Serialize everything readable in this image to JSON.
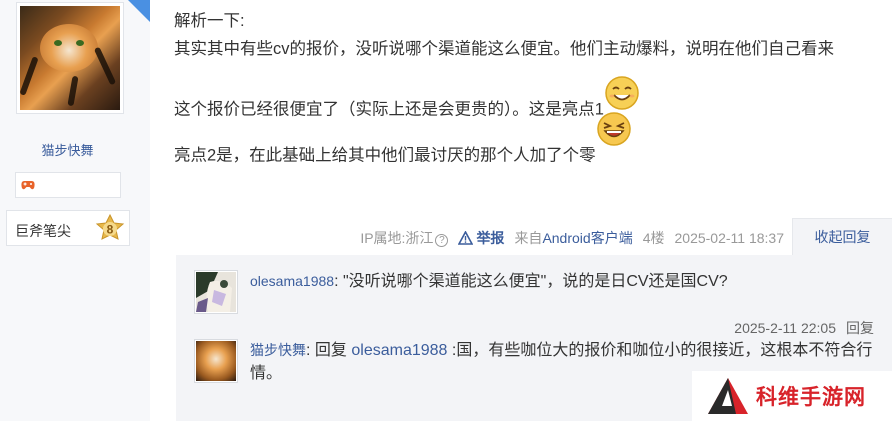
{
  "author": {
    "username": "猫步快舞",
    "level_name": "巨斧笔尖",
    "level": "8"
  },
  "post": {
    "lines": [
      "解析一下:",
      "其实其中有些cv的报价，没听说哪个渠道能这么便宜。他们主动爆料，说明在他们自己看来",
      "这个报价已经很便宜了（实际上还是会更贵的）。这是亮点1",
      "亮点2是，在此基础上给其中他们最讨厌的那个人加了个零"
    ]
  },
  "meta": {
    "ip_location": "IP属地:浙江",
    "help_icon": "?",
    "report": "举报",
    "client_prefix": "来自",
    "client_link": "Android客户端",
    "floor": "4楼",
    "datetime": "2025-02-11 18:37",
    "fold_replies": "收起回复"
  },
  "replies": [
    {
      "user": "olesama1988",
      "separator": ":",
      "text": " \"没听说哪个渠道能这么便宜\"，说的是日CV还是国CV?",
      "datetime": "2025-2-11 22:05",
      "reply_label": "回复"
    },
    {
      "user": "猫步快舞",
      "separator": ":",
      "reply_prefix": " 回复 ",
      "reply_to": "olesama1988",
      "text": " :国，有些咖位大的报价和咖位小的很接近，这根本不符合行情。"
    }
  ],
  "watermark": {
    "text": "科维手游网"
  },
  "colors": {
    "link": "#3b5d9c",
    "muted": "#999999",
    "reply_bg": "#f3f4f7",
    "watermark_red": "#d8232a"
  }
}
